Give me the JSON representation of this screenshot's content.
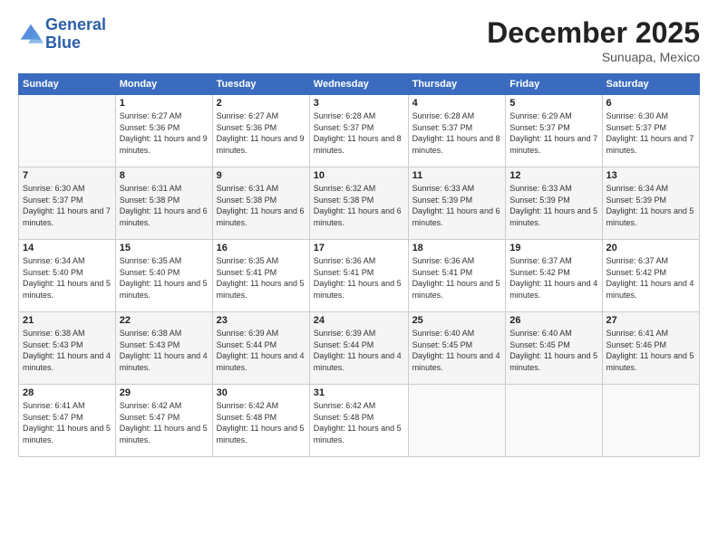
{
  "logo": {
    "line1": "General",
    "line2": "Blue"
  },
  "title": "December 2025",
  "subtitle": "Sunuapa, Mexico",
  "days_header": [
    "Sunday",
    "Monday",
    "Tuesday",
    "Wednesday",
    "Thursday",
    "Friday",
    "Saturday"
  ],
  "weeks": [
    [
      {
        "day": "",
        "sunrise": "",
        "sunset": "",
        "daylight": ""
      },
      {
        "day": "1",
        "sunrise": "Sunrise: 6:27 AM",
        "sunset": "Sunset: 5:36 PM",
        "daylight": "Daylight: 11 hours and 9 minutes."
      },
      {
        "day": "2",
        "sunrise": "Sunrise: 6:27 AM",
        "sunset": "Sunset: 5:36 PM",
        "daylight": "Daylight: 11 hours and 9 minutes."
      },
      {
        "day": "3",
        "sunrise": "Sunrise: 6:28 AM",
        "sunset": "Sunset: 5:37 PM",
        "daylight": "Daylight: 11 hours and 8 minutes."
      },
      {
        "day": "4",
        "sunrise": "Sunrise: 6:28 AM",
        "sunset": "Sunset: 5:37 PM",
        "daylight": "Daylight: 11 hours and 8 minutes."
      },
      {
        "day": "5",
        "sunrise": "Sunrise: 6:29 AM",
        "sunset": "Sunset: 5:37 PM",
        "daylight": "Daylight: 11 hours and 7 minutes."
      },
      {
        "day": "6",
        "sunrise": "Sunrise: 6:30 AM",
        "sunset": "Sunset: 5:37 PM",
        "daylight": "Daylight: 11 hours and 7 minutes."
      }
    ],
    [
      {
        "day": "7",
        "sunrise": "Sunrise: 6:30 AM",
        "sunset": "Sunset: 5:37 PM",
        "daylight": "Daylight: 11 hours and 7 minutes."
      },
      {
        "day": "8",
        "sunrise": "Sunrise: 6:31 AM",
        "sunset": "Sunset: 5:38 PM",
        "daylight": "Daylight: 11 hours and 6 minutes."
      },
      {
        "day": "9",
        "sunrise": "Sunrise: 6:31 AM",
        "sunset": "Sunset: 5:38 PM",
        "daylight": "Daylight: 11 hours and 6 minutes."
      },
      {
        "day": "10",
        "sunrise": "Sunrise: 6:32 AM",
        "sunset": "Sunset: 5:38 PM",
        "daylight": "Daylight: 11 hours and 6 minutes."
      },
      {
        "day": "11",
        "sunrise": "Sunrise: 6:33 AM",
        "sunset": "Sunset: 5:39 PM",
        "daylight": "Daylight: 11 hours and 6 minutes."
      },
      {
        "day": "12",
        "sunrise": "Sunrise: 6:33 AM",
        "sunset": "Sunset: 5:39 PM",
        "daylight": "Daylight: 11 hours and 5 minutes."
      },
      {
        "day": "13",
        "sunrise": "Sunrise: 6:34 AM",
        "sunset": "Sunset: 5:39 PM",
        "daylight": "Daylight: 11 hours and 5 minutes."
      }
    ],
    [
      {
        "day": "14",
        "sunrise": "Sunrise: 6:34 AM",
        "sunset": "Sunset: 5:40 PM",
        "daylight": "Daylight: 11 hours and 5 minutes."
      },
      {
        "day": "15",
        "sunrise": "Sunrise: 6:35 AM",
        "sunset": "Sunset: 5:40 PM",
        "daylight": "Daylight: 11 hours and 5 minutes."
      },
      {
        "day": "16",
        "sunrise": "Sunrise: 6:35 AM",
        "sunset": "Sunset: 5:41 PM",
        "daylight": "Daylight: 11 hours and 5 minutes."
      },
      {
        "day": "17",
        "sunrise": "Sunrise: 6:36 AM",
        "sunset": "Sunset: 5:41 PM",
        "daylight": "Daylight: 11 hours and 5 minutes."
      },
      {
        "day": "18",
        "sunrise": "Sunrise: 6:36 AM",
        "sunset": "Sunset: 5:41 PM",
        "daylight": "Daylight: 11 hours and 5 minutes."
      },
      {
        "day": "19",
        "sunrise": "Sunrise: 6:37 AM",
        "sunset": "Sunset: 5:42 PM",
        "daylight": "Daylight: 11 hours and 4 minutes."
      },
      {
        "day": "20",
        "sunrise": "Sunrise: 6:37 AM",
        "sunset": "Sunset: 5:42 PM",
        "daylight": "Daylight: 11 hours and 4 minutes."
      }
    ],
    [
      {
        "day": "21",
        "sunrise": "Sunrise: 6:38 AM",
        "sunset": "Sunset: 5:43 PM",
        "daylight": "Daylight: 11 hours and 4 minutes."
      },
      {
        "day": "22",
        "sunrise": "Sunrise: 6:38 AM",
        "sunset": "Sunset: 5:43 PM",
        "daylight": "Daylight: 11 hours and 4 minutes."
      },
      {
        "day": "23",
        "sunrise": "Sunrise: 6:39 AM",
        "sunset": "Sunset: 5:44 PM",
        "daylight": "Daylight: 11 hours and 4 minutes."
      },
      {
        "day": "24",
        "sunrise": "Sunrise: 6:39 AM",
        "sunset": "Sunset: 5:44 PM",
        "daylight": "Daylight: 11 hours and 4 minutes."
      },
      {
        "day": "25",
        "sunrise": "Sunrise: 6:40 AM",
        "sunset": "Sunset: 5:45 PM",
        "daylight": "Daylight: 11 hours and 4 minutes."
      },
      {
        "day": "26",
        "sunrise": "Sunrise: 6:40 AM",
        "sunset": "Sunset: 5:45 PM",
        "daylight": "Daylight: 11 hours and 5 minutes."
      },
      {
        "day": "27",
        "sunrise": "Sunrise: 6:41 AM",
        "sunset": "Sunset: 5:46 PM",
        "daylight": "Daylight: 11 hours and 5 minutes."
      }
    ],
    [
      {
        "day": "28",
        "sunrise": "Sunrise: 6:41 AM",
        "sunset": "Sunset: 5:47 PM",
        "daylight": "Daylight: 11 hours and 5 minutes."
      },
      {
        "day": "29",
        "sunrise": "Sunrise: 6:42 AM",
        "sunset": "Sunset: 5:47 PM",
        "daylight": "Daylight: 11 hours and 5 minutes."
      },
      {
        "day": "30",
        "sunrise": "Sunrise: 6:42 AM",
        "sunset": "Sunset: 5:48 PM",
        "daylight": "Daylight: 11 hours and 5 minutes."
      },
      {
        "day": "31",
        "sunrise": "Sunrise: 6:42 AM",
        "sunset": "Sunset: 5:48 PM",
        "daylight": "Daylight: 11 hours and 5 minutes."
      },
      {
        "day": "",
        "sunrise": "",
        "sunset": "",
        "daylight": ""
      },
      {
        "day": "",
        "sunrise": "",
        "sunset": "",
        "daylight": ""
      },
      {
        "day": "",
        "sunrise": "",
        "sunset": "",
        "daylight": ""
      }
    ]
  ]
}
